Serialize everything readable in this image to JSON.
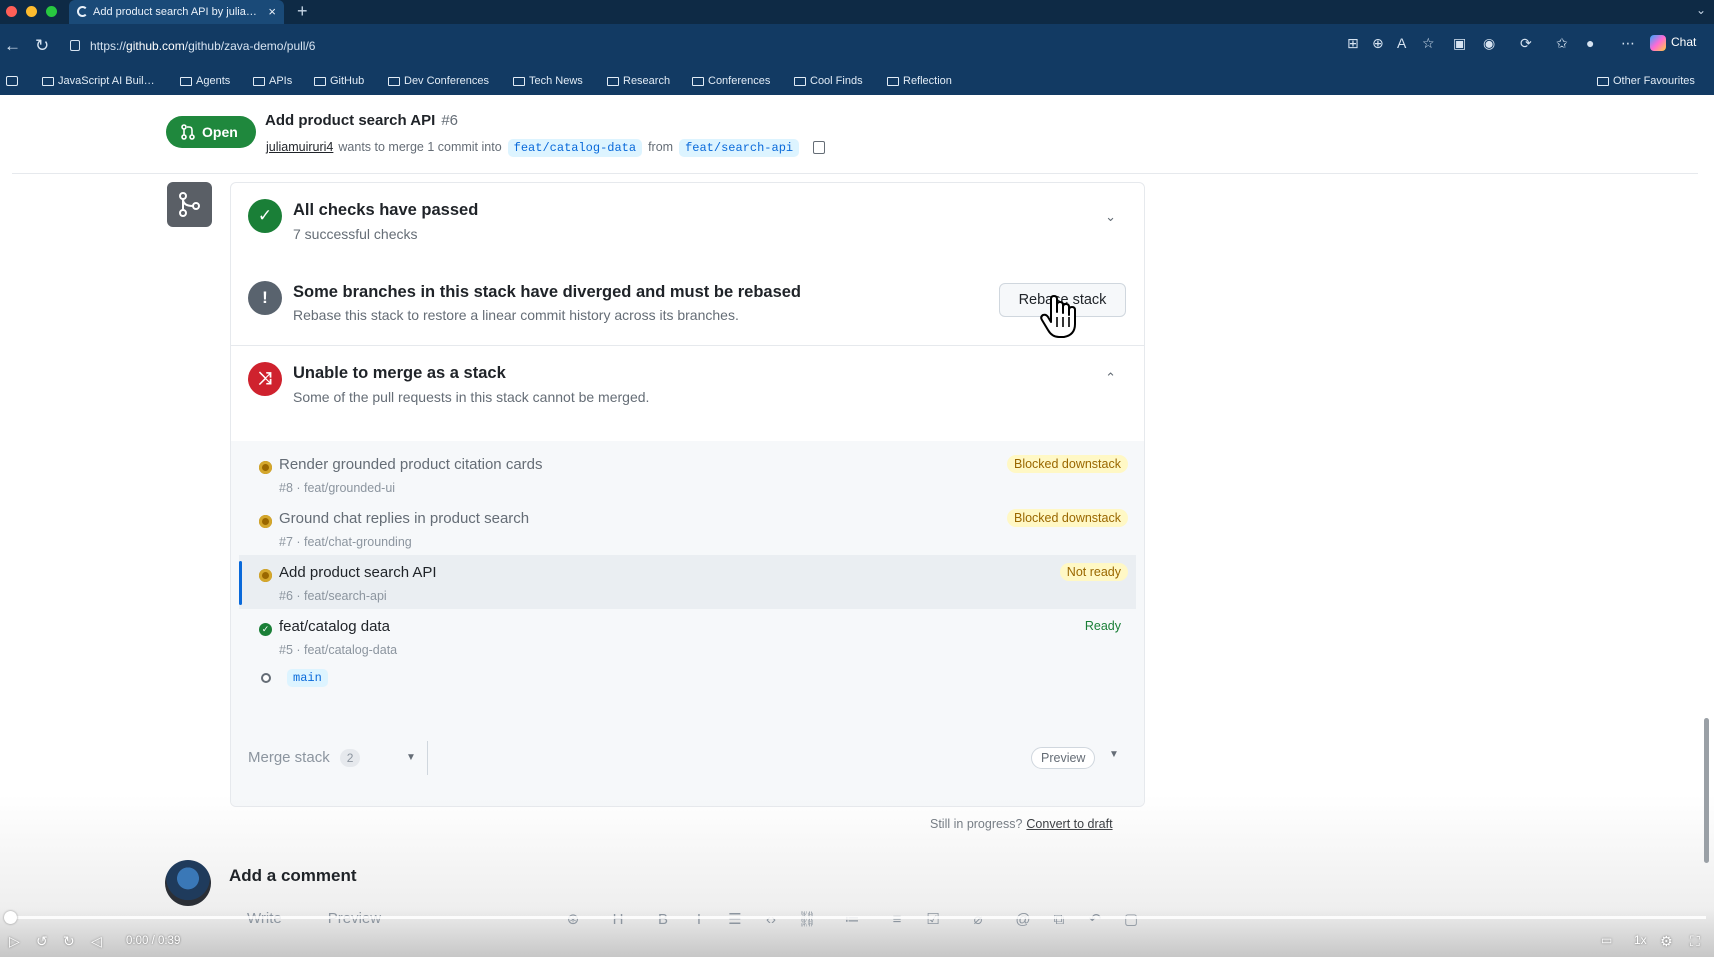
{
  "browser": {
    "tab_title": "Add product search API by julia…",
    "new_tab": "+",
    "url_prefix": "https://",
    "url_host": "github.com",
    "url_path": "/github/zava-demo/pull/6",
    "chat_label": "Chat",
    "bookmarks": [
      "JavaScript AI Buil…",
      "Agents",
      "APIs",
      "GitHub",
      "Dev Conferences",
      "Tech News",
      "Research",
      "Conferences",
      "Cool Finds",
      "Reflection"
    ],
    "other_favourites": "Other Favourites"
  },
  "pr": {
    "state": "Open",
    "title": "Add product search API",
    "number": "#6",
    "author": "juliamuiruri4",
    "merge_text": "wants to merge 1 commit into",
    "base_branch": "feat/catalog-data",
    "from_text": "from",
    "head_branch": "feat/search-api"
  },
  "checks": {
    "title": "All checks have passed",
    "desc": "7 successful checks"
  },
  "diverged": {
    "title": "Some branches in this stack have diverged and must be rebased",
    "desc": "Rebase this stack to restore a linear commit history across its branches.",
    "button": "Rebase stack"
  },
  "merge_block": {
    "title": "Unable to merge as a stack",
    "desc": "Some of the pull requests in this stack cannot be merged."
  },
  "stack": [
    {
      "title": "Render grounded product citation cards",
      "sub": "#8 · feat/grounded-ui",
      "badge": "Blocked downstack"
    },
    {
      "title": "Ground chat replies in product search",
      "sub": "#7 · feat/chat-grounding",
      "badge": "Blocked downstack"
    },
    {
      "title": "Add product search API",
      "sub": "#6 · feat/search-api",
      "badge": "Not ready"
    },
    {
      "title": "feat/catalog data",
      "sub": "#5 · feat/catalog-data",
      "badge": "Ready"
    }
  ],
  "stack_base": "main",
  "merge_stack": {
    "label": "Merge stack",
    "count": "2",
    "preview": "Preview"
  },
  "draft": {
    "question": "Still in progress?",
    "link": "Convert to draft"
  },
  "comment": {
    "title": "Add a comment",
    "tab_write": "Write",
    "tab_preview": "Preview"
  },
  "player": {
    "time": "0:00 / 0:39",
    "speed": "1x"
  },
  "colors": {
    "open_green": "#1f883d",
    "success": "#1a7f37",
    "danger": "#cf222e",
    "attention": "#9a6700",
    "accent": "#0969da"
  }
}
